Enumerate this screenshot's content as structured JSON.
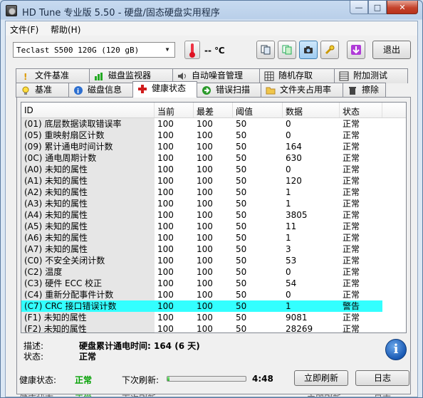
{
  "window": {
    "title": "HD Tune 专业版 5.50 - 硬盘/固态硬盘实用程序",
    "minimize": "—",
    "maximize": "□",
    "close": "✕"
  },
  "menu": {
    "file": "文件(F)",
    "help": "帮助(H)"
  },
  "toolbar": {
    "drive": "Teclast S500 120G (120 gB)",
    "temperature": "-- ℃",
    "exit": "退出"
  },
  "tabs_top": [
    "文件基准",
    "磁盘监视器",
    "自动噪音管理",
    "随机存取",
    "附加测试"
  ],
  "tabs_bottom": [
    "基准",
    "磁盘信息",
    "健康状态",
    "错误扫描",
    "文件夹占用率",
    "擦除"
  ],
  "active_tab": "健康状态",
  "columns": [
    "ID",
    "当前",
    "最差",
    "阈值",
    "数据",
    "状态"
  ],
  "rows": [
    [
      "(01) 底层数据读取错误率",
      "100",
      "100",
      "50",
      "0",
      "正常"
    ],
    [
      "(05) 重映射扇区计数",
      "100",
      "100",
      "50",
      "0",
      "正常"
    ],
    [
      "(09) 累计通电时间计数",
      "100",
      "100",
      "50",
      "164",
      "正常"
    ],
    [
      "(0C) 通电周期计数",
      "100",
      "100",
      "50",
      "630",
      "正常"
    ],
    [
      "(A0) 未知的属性",
      "100",
      "100",
      "50",
      "0",
      "正常"
    ],
    [
      "(A1) 未知的属性",
      "100",
      "100",
      "50",
      "120",
      "正常"
    ],
    [
      "(A2) 未知的属性",
      "100",
      "100",
      "50",
      "1",
      "正常"
    ],
    [
      "(A3) 未知的属性",
      "100",
      "100",
      "50",
      "1",
      "正常"
    ],
    [
      "(A4) 未知的属性",
      "100",
      "100",
      "50",
      "3805",
      "正常"
    ],
    [
      "(A5) 未知的属性",
      "100",
      "100",
      "50",
      "11",
      "正常"
    ],
    [
      "(A6) 未知的属性",
      "100",
      "100",
      "50",
      "1",
      "正常"
    ],
    [
      "(A7) 未知的属性",
      "100",
      "100",
      "50",
      "3",
      "正常"
    ],
    [
      "(C0) 不安全关闭计数",
      "100",
      "100",
      "50",
      "53",
      "正常"
    ],
    [
      "(C2) 温度",
      "100",
      "100",
      "50",
      "0",
      "正常"
    ],
    [
      "(C3) 硬件 ECC 校正",
      "100",
      "100",
      "50",
      "54",
      "正常"
    ],
    [
      "(C4) 重新分配事件计数",
      "100",
      "100",
      "50",
      "0",
      "正常"
    ],
    [
      "(C7) CRC 接口错误计数",
      "100",
      "100",
      "50",
      "1",
      "警告"
    ],
    [
      "(F1) 未知的属性",
      "100",
      "100",
      "50",
      "9081",
      "正常"
    ],
    [
      "(F2) 未知的属性",
      "100",
      "100",
      "50",
      "28269",
      "正常"
    ]
  ],
  "selected_row": 16,
  "info": {
    "desc_label": "描述:",
    "desc_value": "硬盘累计通电时间: 164 (6 天)",
    "status_label": "状态:",
    "status_value": "正常"
  },
  "status": {
    "health_label": "健康状态:",
    "health_value": "正常",
    "refresh_label": "下次刷新:",
    "progress_fraction": 0.03,
    "countdown": "4:48",
    "refresh_button": "立即刷新",
    "log_button": "日志"
  },
  "colors": {
    "selected_row": "#33ffff",
    "health_ok": "#00a000"
  }
}
